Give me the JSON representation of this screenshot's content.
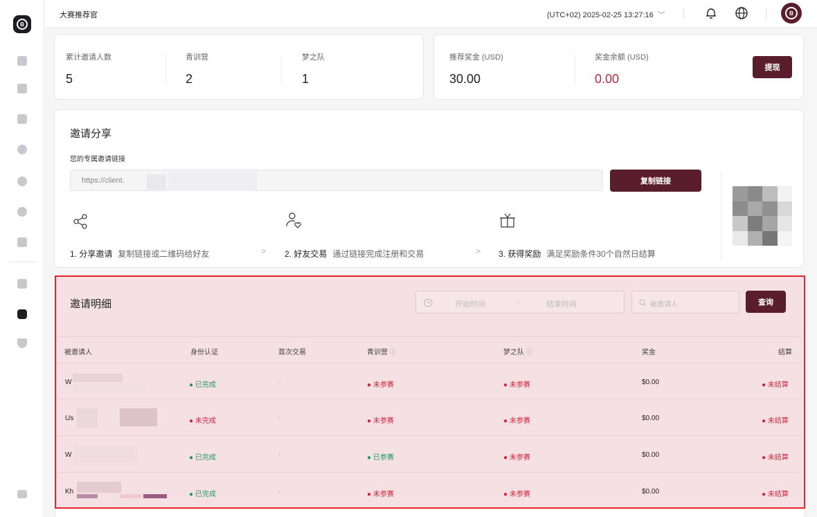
{
  "sidebar": {
    "icons": [
      "home-icon",
      "card-icon",
      "chart-icon",
      "box-icon",
      "user-icon",
      "help-icon",
      "calendar-icon",
      "exchange-icon",
      "referral-icon",
      "trophy-icon",
      "collapse-icon"
    ]
  },
  "header": {
    "title": "大赛推荐官",
    "timezone": "(UTC+02)  2025-02-25 13:27:16",
    "chevron": "﹀"
  },
  "stats": {
    "invites_label": "累计邀请人数",
    "invites_value": "5",
    "youth_label": "青训营",
    "youth_value": "2",
    "dream_label": "梦之队",
    "dream_value": "1",
    "reward_label": "推荐奖金 (USD)",
    "reward_value": "30.00",
    "balance_label": "奖金余额 (USD)",
    "balance_value": "0.00",
    "withdraw_label": "提现"
  },
  "share": {
    "title": "邀请分享",
    "sub": "您的专属邀请链接",
    "url": "https://client.",
    "copy_label": "复制链接",
    "steps": [
      {
        "title": "1. 分享邀请",
        "desc": "复制链接或二维码给好友"
      },
      {
        "title": "2. 好友交易",
        "desc": "通过链接完成注册和交易"
      },
      {
        "title": "3. 获得奖励",
        "desc": "满足奖励条件30个自然日结算"
      }
    ],
    "arrow": ">"
  },
  "detail": {
    "title": "邀请明细",
    "start_placeholder": "开始时间",
    "range_sep": "-",
    "end_placeholder": "结束时间",
    "search_placeholder": "被邀请人",
    "query_label": "查询",
    "headers": [
      "被邀请人",
      "身份认证",
      "首次交易",
      "青训营",
      "梦之队",
      "奖金",
      "结算"
    ],
    "rows": [
      {
        "name": "W",
        "kyc": "已完成",
        "first": "-",
        "youth": "未参赛",
        "dream": "未参赛",
        "bonus": "$0.00",
        "settle": "未结算"
      },
      {
        "name": "Us",
        "kyc": "未完成",
        "first": "-",
        "youth": "未参赛",
        "dream": "未参赛",
        "bonus": "$0.00",
        "settle": "未结算"
      },
      {
        "name": "W",
        "kyc": "已完成",
        "first": "-",
        "youth": "已参赛",
        "dream": "未参赛",
        "bonus": "$0.00",
        "settle": "未结算"
      },
      {
        "name": "Kh",
        "kyc": "已完成",
        "first": "-",
        "youth": "未参赛",
        "dream": "未参赛",
        "bonus": "$0.00",
        "settle": "未结算"
      }
    ]
  },
  "colors": {
    "brand": "#5a1d2c",
    "highlight_border": "#e2262e",
    "positive": "#1f9a5a",
    "negative": "#d3243b"
  }
}
